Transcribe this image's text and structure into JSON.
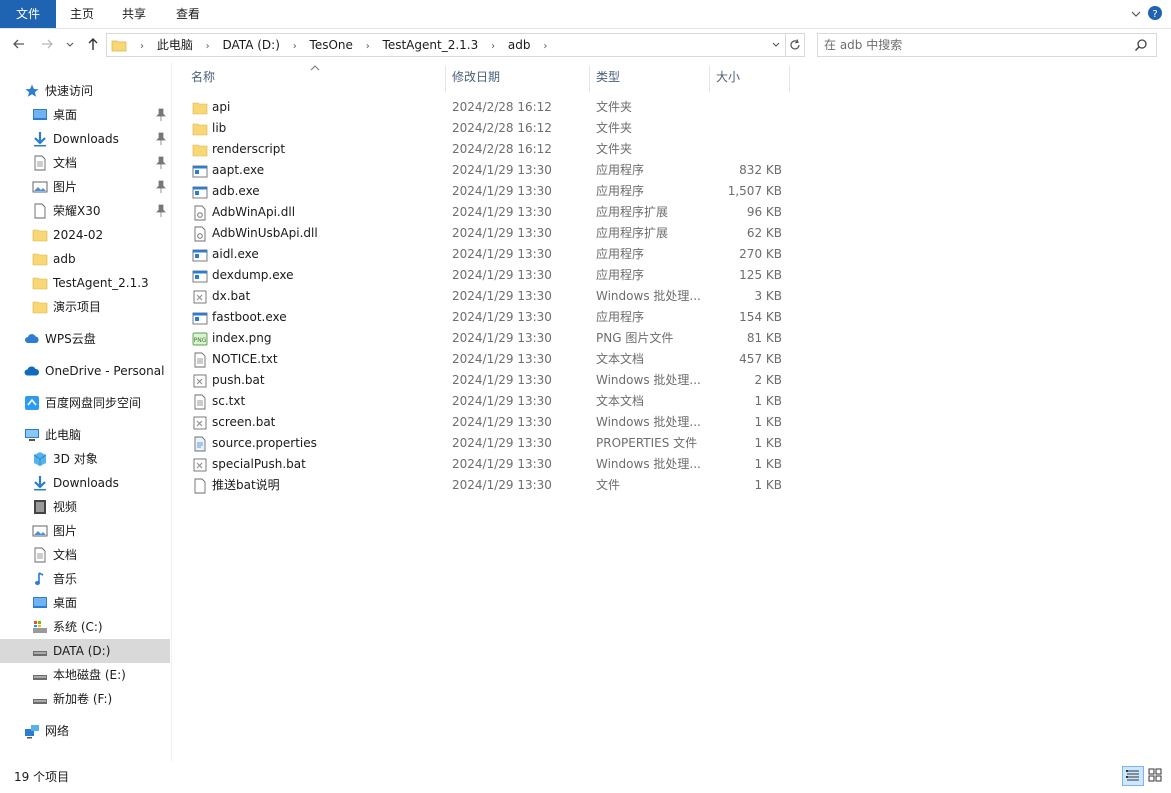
{
  "ribbon": {
    "tabs": [
      "文件",
      "主页",
      "共享",
      "查看"
    ]
  },
  "address": {
    "crumbs": [
      "此电脑",
      "DATA (D:)",
      "TesOne",
      "TestAgent_2.1.3",
      "adb"
    ]
  },
  "search": {
    "placeholder": "在 adb 中搜索"
  },
  "sidebar": {
    "quick_access": "快速访问",
    "quick_items": [
      "桌面",
      "Downloads",
      "文档",
      "图片",
      "荣耀X30",
      "2024-02",
      "adb",
      "TestAgent_2.1.3",
      "演示项目"
    ],
    "wps": "WPS云盘",
    "onedrive": "OneDrive - Personal",
    "baidu": "百度网盘同步空间",
    "this_pc": "此电脑",
    "pc_items": [
      "3D 对象",
      "Downloads",
      "视频",
      "图片",
      "文档",
      "音乐",
      "桌面",
      "系统 (C:)",
      "DATA (D:)",
      "本地磁盘 (E:)",
      "新加卷 (F:)"
    ],
    "network": "网络"
  },
  "columns": {
    "name": "名称",
    "date": "修改日期",
    "type": "类型",
    "size": "大小"
  },
  "files": [
    {
      "name": "api",
      "date": "2024/2/28 16:12",
      "type": "文件夹",
      "size": "",
      "icon": "folder-icon"
    },
    {
      "name": "lib",
      "date": "2024/2/28 16:12",
      "type": "文件夹",
      "size": "",
      "icon": "folder-icon"
    },
    {
      "name": "renderscript",
      "date": "2024/2/28 16:12",
      "type": "文件夹",
      "size": "",
      "icon": "folder-icon"
    },
    {
      "name": "aapt.exe",
      "date": "2024/1/29 13:30",
      "type": "应用程序",
      "size": "832 KB",
      "icon": "exe-icon"
    },
    {
      "name": "adb.exe",
      "date": "2024/1/29 13:30",
      "type": "应用程序",
      "size": "1,507 KB",
      "icon": "exe-icon"
    },
    {
      "name": "AdbWinApi.dll",
      "date": "2024/1/29 13:30",
      "type": "应用程序扩展",
      "size": "96 KB",
      "icon": "dll-icon"
    },
    {
      "name": "AdbWinUsbApi.dll",
      "date": "2024/1/29 13:30",
      "type": "应用程序扩展",
      "size": "62 KB",
      "icon": "dll-icon"
    },
    {
      "name": "aidl.exe",
      "date": "2024/1/29 13:30",
      "type": "应用程序",
      "size": "270 KB",
      "icon": "exe-icon"
    },
    {
      "name": "dexdump.exe",
      "date": "2024/1/29 13:30",
      "type": "应用程序",
      "size": "125 KB",
      "icon": "exe-icon"
    },
    {
      "name": "dx.bat",
      "date": "2024/1/29 13:30",
      "type": "Windows 批处理...",
      "size": "3 KB",
      "icon": "bat-icon"
    },
    {
      "name": "fastboot.exe",
      "date": "2024/1/29 13:30",
      "type": "应用程序",
      "size": "154 KB",
      "icon": "exe-icon"
    },
    {
      "name": "index.png",
      "date": "2024/1/29 13:30",
      "type": "PNG 图片文件",
      "size": "81 KB",
      "icon": "png-icon"
    },
    {
      "name": "NOTICE.txt",
      "date": "2024/1/29 13:30",
      "type": "文本文档",
      "size": "457 KB",
      "icon": "txt-icon"
    },
    {
      "name": "push.bat",
      "date": "2024/1/29 13:30",
      "type": "Windows 批处理...",
      "size": "2 KB",
      "icon": "bat-icon"
    },
    {
      "name": "sc.txt",
      "date": "2024/1/29 13:30",
      "type": "文本文档",
      "size": "1 KB",
      "icon": "txt-icon"
    },
    {
      "name": "screen.bat",
      "date": "2024/1/29 13:30",
      "type": "Windows 批处理...",
      "size": "1 KB",
      "icon": "bat-icon"
    },
    {
      "name": "source.properties",
      "date": "2024/1/29 13:30",
      "type": "PROPERTIES 文件",
      "size": "1 KB",
      "icon": "properties-icon"
    },
    {
      "name": "specialPush.bat",
      "date": "2024/1/29 13:30",
      "type": "Windows 批处理...",
      "size": "1 KB",
      "icon": "bat-icon"
    },
    {
      "name": "推送bat说明",
      "date": "2024/1/29 13:30",
      "type": "文件",
      "size": "1 KB",
      "icon": "file-icon"
    }
  ],
  "status": {
    "count": "19 个项目"
  },
  "colors": {
    "file_tab": "#1f63b3",
    "folder": "#f8d775",
    "selected": "#d9d9d9"
  }
}
